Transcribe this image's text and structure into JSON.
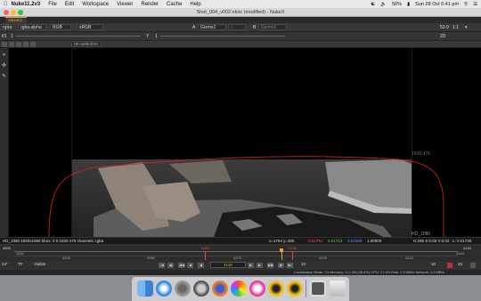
{
  "menubar": {
    "app_name": "Nuke11.2v3",
    "menus": [
      "File",
      "Edit",
      "Workspace",
      "Viewer",
      "Render",
      "Cache",
      "Help"
    ],
    "battery": "56%",
    "datetime": "Sun 28 Oct 6:41 pm"
  },
  "window": {
    "title": "Shot_004_v002.nknc (modified) - NukeX"
  },
  "viewer_tab": {
    "label": "Viewer1"
  },
  "toolbar1": {
    "channels": "rgba",
    "layer": "rgba.alpha",
    "display": "RGB",
    "colorspace": "sRGB",
    "input_a_label": "A",
    "input_a": "Gizmo1",
    "op": "-",
    "input_b_label": "B",
    "input_b": "Gizmo1",
    "zoom": "53.9",
    "ratio": "1:1"
  },
  "toolbar2": {
    "gain": "f/1",
    "gain_value": "1",
    "gamma_label": "Y",
    "gamma_value": "1",
    "view_mode": "2D"
  },
  "toolbar3": {
    "proxy_field": "un-selection"
  },
  "viewer": {
    "crop_label": "1920,475",
    "format_label": "HD_1080"
  },
  "info_bar": {
    "left": "HD_1080 1920x1080  bbox: 0 0 1920 475 channels: rgba",
    "coords": "x=1764 y=305",
    "r": "0.01794",
    "g": "0.01713",
    "b": "0.01580",
    "a": "1.00000",
    "hsv": "H:205 S:0.05 V:0.02",
    "luma": "L: 0.01735"
  },
  "timeline": {
    "start": "1001",
    "end": "4140",
    "start_field": "4000",
    "end_field": "4142",
    "ticks": [
      "4025",
      "4050",
      "4075",
      "4100",
      "4125"
    ],
    "ticks_top": [
      "4025",
      "4050",
      "4075",
      "4100",
      "4125"
    ],
    "in_marker": "4095",
    "out_marker": "4130"
  },
  "playback": {
    "fps": "24*",
    "tf": "TF",
    "visibility": "Visible",
    "current_frame": "4130",
    "increment": "10",
    "skip": "10",
    "repeat": "33"
  },
  "statusbar": {
    "text": "Localization Mode: On  Memory: 0.1 GB (38.2%)  CPU: 17.4%  Disk: 0.0 MB/s  Network: 0.0 MB/s"
  },
  "dock": {
    "icons": [
      "finder-icon",
      "safari-icon",
      "system-prefs-icon",
      "launchpad-icon",
      "firefox-icon",
      "photos-icon",
      "itunes-icon",
      "nuke-icon",
      "nuke-x-icon",
      "preview-icon",
      "trash-icon"
    ]
  },
  "colors": {
    "accent": "#f2a02a",
    "roi": "#cc2020",
    "menubar": "#e8e8ea"
  }
}
